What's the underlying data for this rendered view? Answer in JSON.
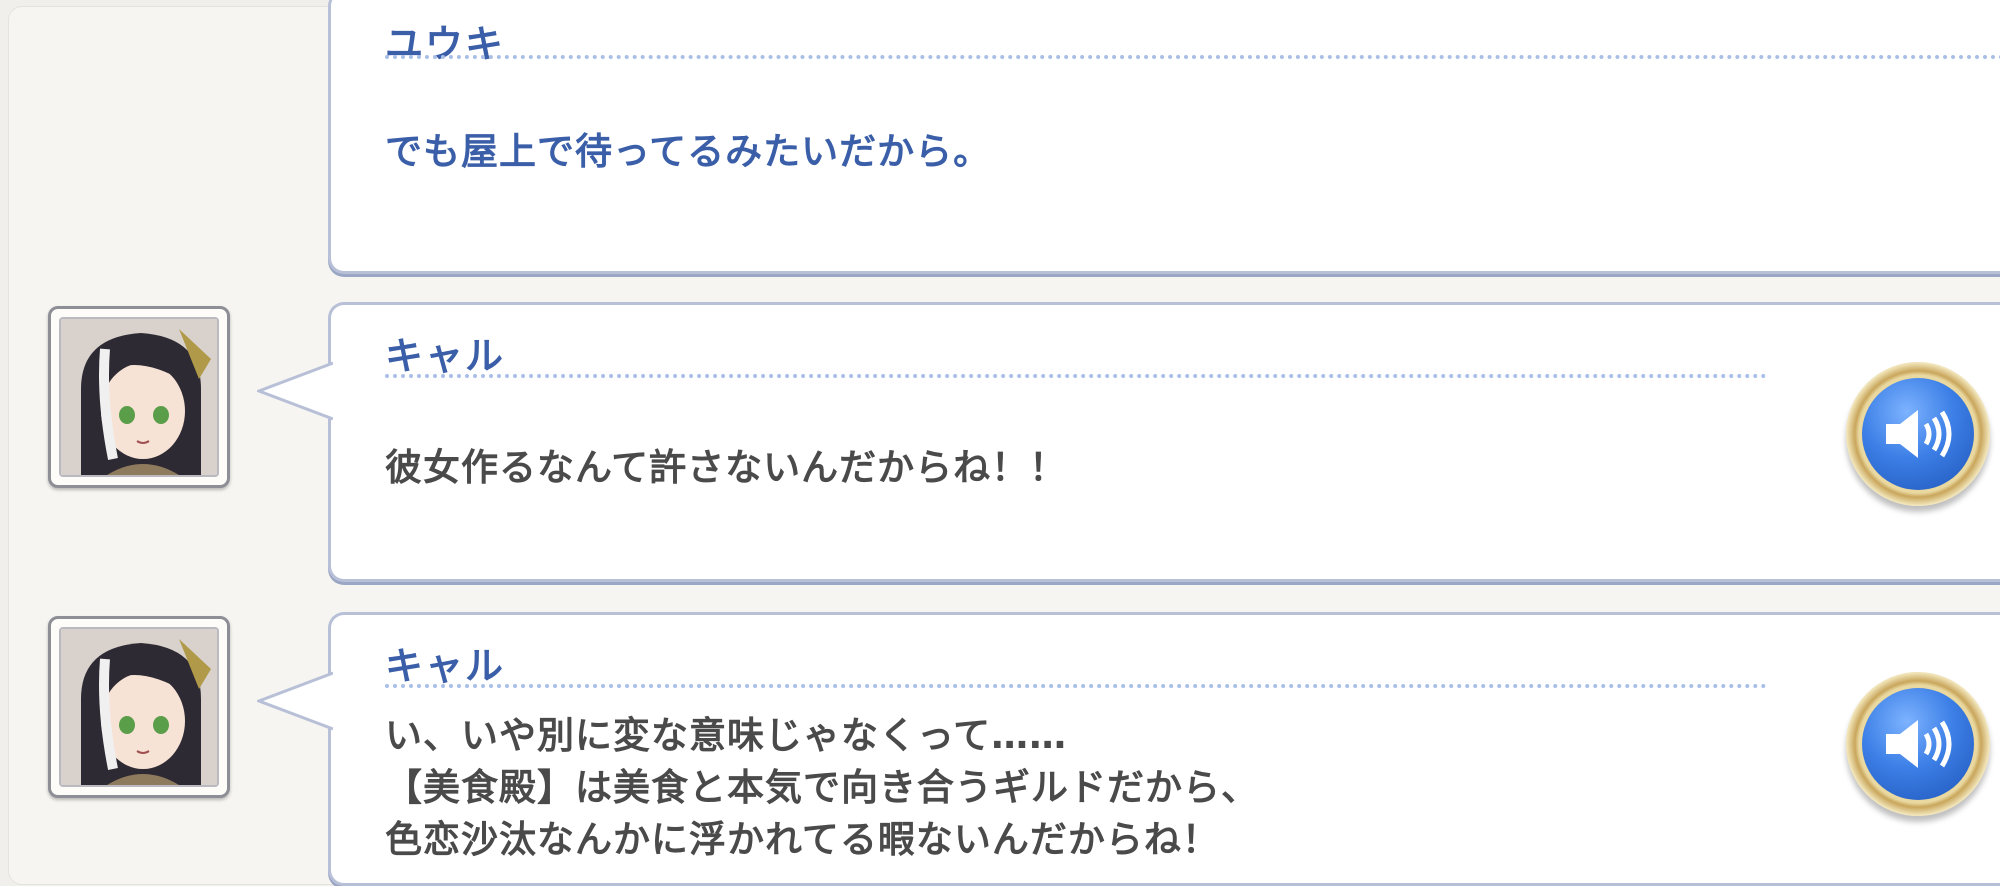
{
  "messages": [
    {
      "speaker": "ユウキ",
      "lines": [
        "でも屋上で待ってるみたいだから。"
      ],
      "text_color": "#3a5fa8",
      "has_voice": false
    },
    {
      "speaker": "キャル",
      "lines": [
        "彼女作るなんて許さないんだからね！！"
      ],
      "text_color": "#4a4a4a",
      "has_voice": true,
      "avatar": "cat-eared-girl-portrait"
    },
    {
      "speaker": "キャル",
      "lines": [
        "い、いや別に変な意味じゃなくって……",
        "【美食殿】は美食と本気で向き合うギルドだから、",
        "色恋沙汰なんかに浮かれてる暇ないんだからね！"
      ],
      "text_color": "#4a4a4a",
      "has_voice": true,
      "avatar": "cat-eared-girl-portrait"
    }
  ],
  "icons": {
    "voice_button": "speaker-volume-icon"
  },
  "colors": {
    "speaker_name": "#3a5fa8",
    "player_text": "#3a5fa8",
    "npc_text": "#4a4a4a",
    "voice_button_core": "#3c7fe6",
    "voice_button_rim": "#c9a65c"
  }
}
